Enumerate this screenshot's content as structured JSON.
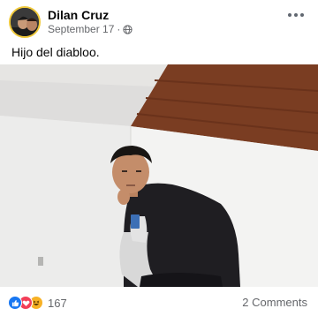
{
  "post": {
    "author": "Dilan Cruz",
    "date": "September 17",
    "separator": "·",
    "caption": "Hijo del diabloo."
  },
  "icons": {
    "privacy": "globe-icon",
    "menu": "more-options-icon",
    "reactions": [
      "like-icon",
      "love-icon",
      "haha-icon"
    ]
  },
  "footer": {
    "reaction_count": "167",
    "comments": "2 Comments"
  },
  "colors": {
    "like": "#1877f2",
    "love": "#f33e58",
    "haha": "#f7b125",
    "secondary_text": "#65676b"
  }
}
